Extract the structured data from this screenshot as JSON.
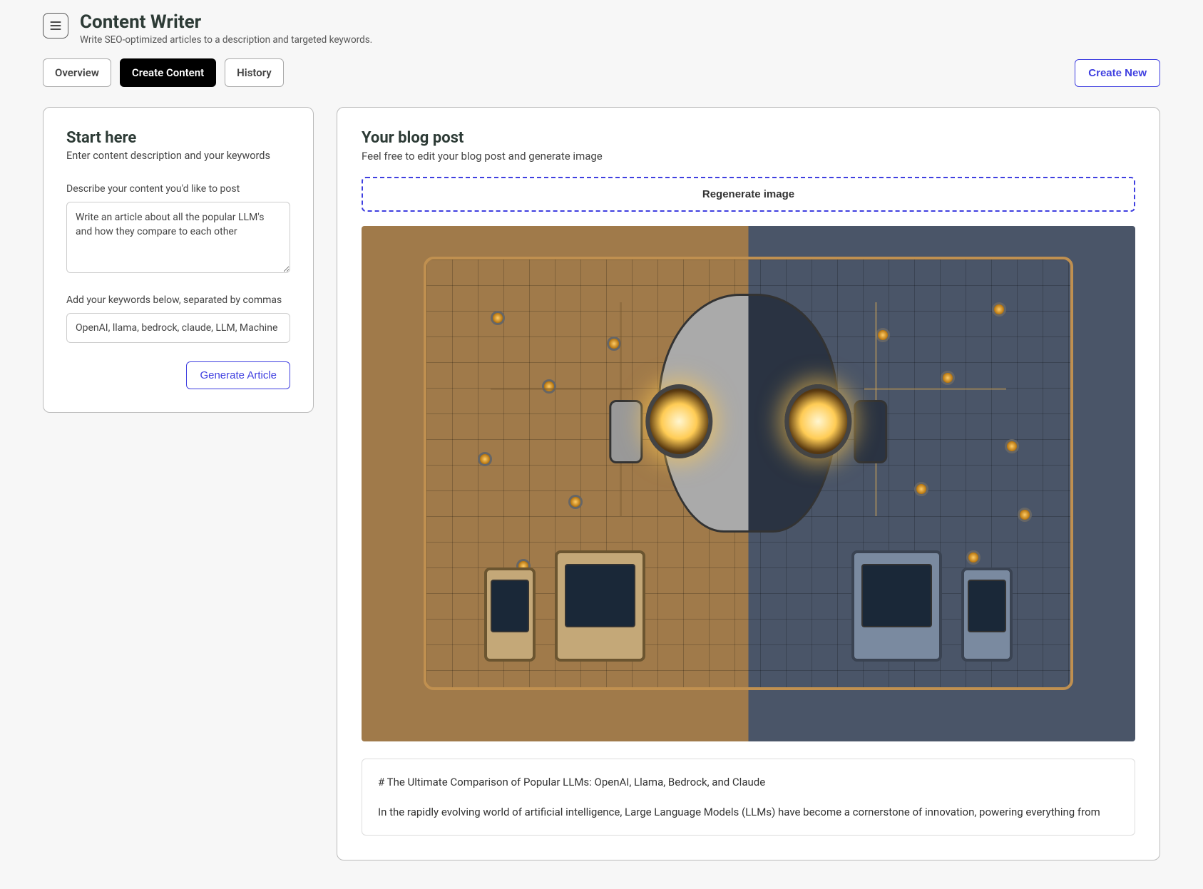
{
  "header": {
    "title": "Content Writer",
    "subtitle": "Write SEO-optimized articles to a description and targeted keywords."
  },
  "tabs": {
    "overview": "Overview",
    "create": "Create Content",
    "history": "History"
  },
  "create_new_label": "Create New",
  "sidebar": {
    "title": "Start here",
    "subtitle": "Enter content description and your keywords",
    "desc_label": "Describe your content you'd like to post",
    "desc_value": "Write an article about all the popular LLM's and how they compare to each other",
    "kw_label": "Add your keywords below, separated by commas",
    "kw_value": "OpenAI, llama, bedrock, claude, LLM, Machine Learning",
    "generate_label": "Generate Article"
  },
  "main": {
    "title": "Your blog post",
    "subtitle": "Feel free to edit your blog post and generate image",
    "regen_label": "Regenerate image",
    "article_heading": "# The Ultimate Comparison of Popular LLMs: OpenAI, Llama, Bedrock, and Claude",
    "article_intro": "In the rapidly evolving world of artificial intelligence, Large Language Models (LLMs) have become a cornerstone of innovation, powering everything from"
  }
}
